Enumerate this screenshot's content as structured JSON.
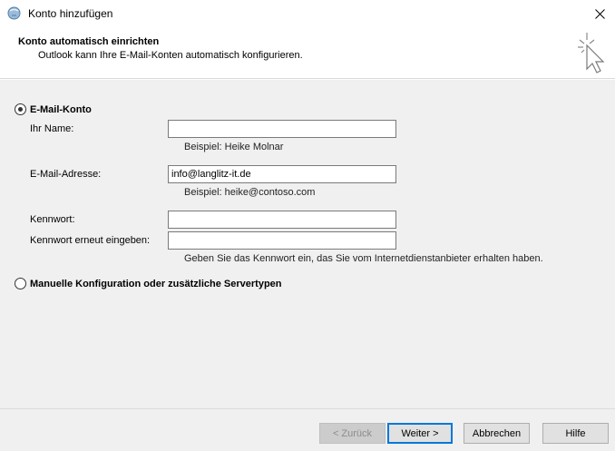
{
  "window": {
    "title": "Konto hinzufügen"
  },
  "header": {
    "title": "Konto automatisch einrichten",
    "subtitle": "Outlook kann Ihre E-Mail-Konten automatisch konfigurieren."
  },
  "email_account": {
    "option_label": "E-Mail-Konto",
    "selected": true,
    "name": {
      "label": "Ihr Name:",
      "value": "",
      "hint": "Beispiel: Heike Molnar"
    },
    "email": {
      "label": "E-Mail-Adresse:",
      "value": "info@langlitz-it.de",
      "hint": "Beispiel: heike@contoso.com"
    },
    "password": {
      "label": "Kennwort:",
      "value": ""
    },
    "password_repeat": {
      "label": "Kennwort erneut eingeben:",
      "value": "",
      "hint": "Geben Sie das Kennwort ein, das Sie vom Internetdienstanbieter erhalten haben."
    }
  },
  "manual_config": {
    "option_label": "Manuelle Konfiguration oder zusätzliche Servertypen",
    "selected": false
  },
  "footer": {
    "back_label": "< Zurück",
    "next_label": "Weiter >",
    "cancel_label": "Abbrechen",
    "help_label": "Hilfe"
  }
}
